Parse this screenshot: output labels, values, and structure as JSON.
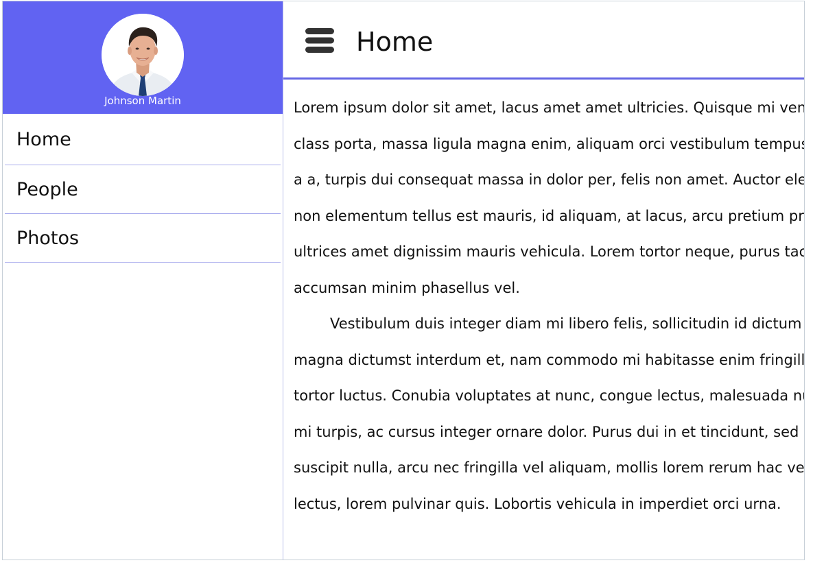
{
  "profile": {
    "name": "Johnson Martin",
    "avatar_icon": "user-avatar-photo"
  },
  "header": {
    "menu_icon": "hamburger-menu-icon",
    "title": "Home"
  },
  "nav": {
    "items": [
      {
        "label": "Home"
      },
      {
        "label": "People"
      },
      {
        "label": "Photos"
      }
    ]
  },
  "content": {
    "lines": [
      "Lorem ipsum dolor sit amet, lacus amet amet ultricies. Quisque mi vene",
      "class porta, massa ligula magna enim, aliquam orci vestibulum tempus.",
      "a a, turpis dui consequat massa in dolor per, felis non amet. Auctor ele",
      "non elementum tellus est mauris, id aliquam, at lacus, arcu pretium pro",
      "ultrices amet dignissim mauris vehicula. Lorem tortor neque, purus taci",
      "accumsan minim phasellus vel.",
      "Vestibulum duis integer diam mi libero felis, sollicitudin id dictum",
      "magna dictumst interdum et, nam commodo mi habitasse enim fringill",
      "tortor luctus. Conubia voluptates at nunc, congue lectus, malesuada nu",
      "mi turpis, ac cursus integer ornare dolor. Purus dui in et tincidunt, sed",
      "suscipit nulla, arcu nec fringilla vel aliquam, mollis lorem rerum hac ves",
      "lectus, lorem pulvinar quis. Lobortis vehicula in imperdiet orci urna."
    ]
  },
  "colors": {
    "accent": "#6163f2",
    "divider": "#a9aced",
    "text": "#111111"
  }
}
